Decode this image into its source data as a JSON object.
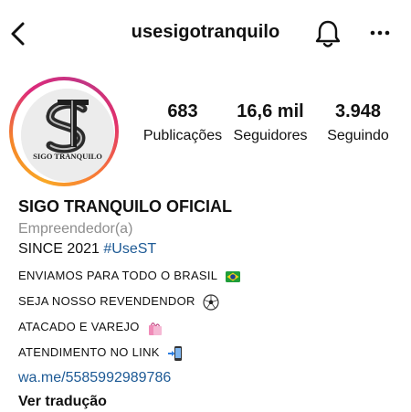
{
  "header": {
    "username": "usesigotranquilo",
    "back_icon": "chevron-left-icon",
    "bell_icon": "bell-icon",
    "more_icon": "more-horizontal-icon"
  },
  "profile": {
    "avatar_logo_text": "SIGO TRANQUILO",
    "avatar_ring_colors": [
      "#f9a826",
      "#f58529",
      "#dd2a7b",
      "#c13584"
    ]
  },
  "stats": [
    {
      "value": "683",
      "label": "Publicações"
    },
    {
      "value": "16,6 mil",
      "label": "Seguidores"
    },
    {
      "value": "3.948",
      "label": "Seguindo"
    }
  ],
  "bio": {
    "name": "SIGO TRANQUILO OFICIAL",
    "category": "Empreendedor(a)",
    "since_text": "SINCE 2021 ",
    "hashtag": "#UseST",
    "lines": [
      {
        "text": "ENVIAMOS PARA TODO O BRASIL",
        "emoji": "brazil-flag-icon"
      },
      {
        "text": "SEJA NOSSO REVENDENDOR",
        "emoji": "soccer-ball-icon"
      },
      {
        "text": "ATACADO E VAREJO",
        "emoji": "shopping-bags-icon"
      },
      {
        "text": "ATENDIMENTO NO LINK",
        "emoji": "mobile-phone-arrow-icon"
      }
    ],
    "link": "wa.me/5585992989786",
    "translate": "Ver tradução"
  },
  "colors": {
    "link": "#1d5a95",
    "category": "#8e8e8e",
    "text": "#111111"
  }
}
